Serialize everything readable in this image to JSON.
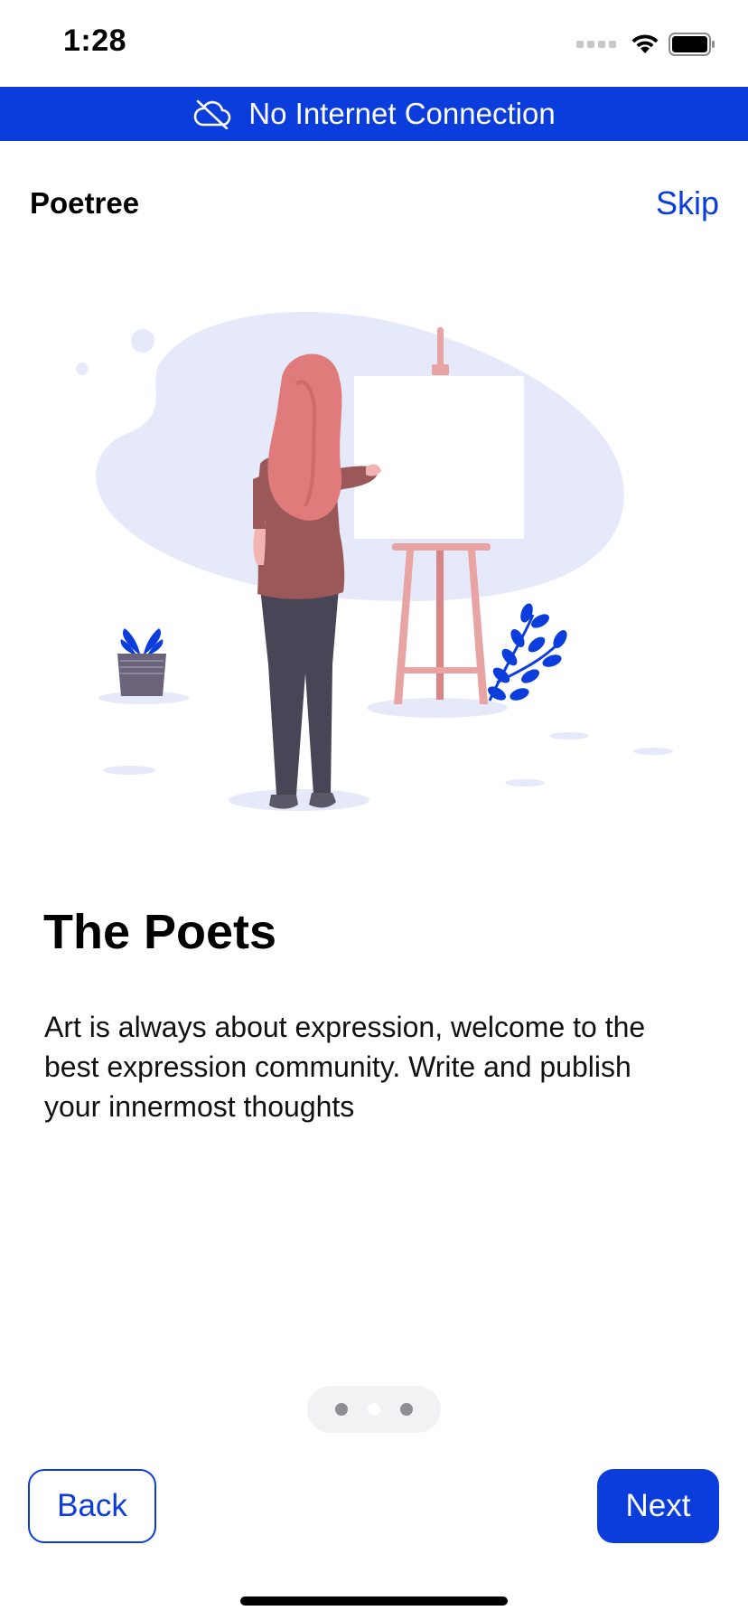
{
  "theme": {
    "accent": "#0a3ddc"
  },
  "status_bar": {
    "time": "1:28",
    "icons": [
      "cellular-signal-icon",
      "wifi-icon",
      "battery-icon"
    ]
  },
  "banner": {
    "icon": "cloud-offline-icon",
    "text": "No Internet Connection"
  },
  "header": {
    "app_name": "Poetree",
    "skip_label": "Skip"
  },
  "onboarding": {
    "title": "The Poets",
    "description": "Art is always about expression, welcome to the best expression community. Write and publish your innermost thoughts",
    "illustration": "woman-painting-at-easel-illustration",
    "pages": 3,
    "current_page": 2
  },
  "navigation": {
    "back_label": "Back",
    "next_label": "Next"
  }
}
